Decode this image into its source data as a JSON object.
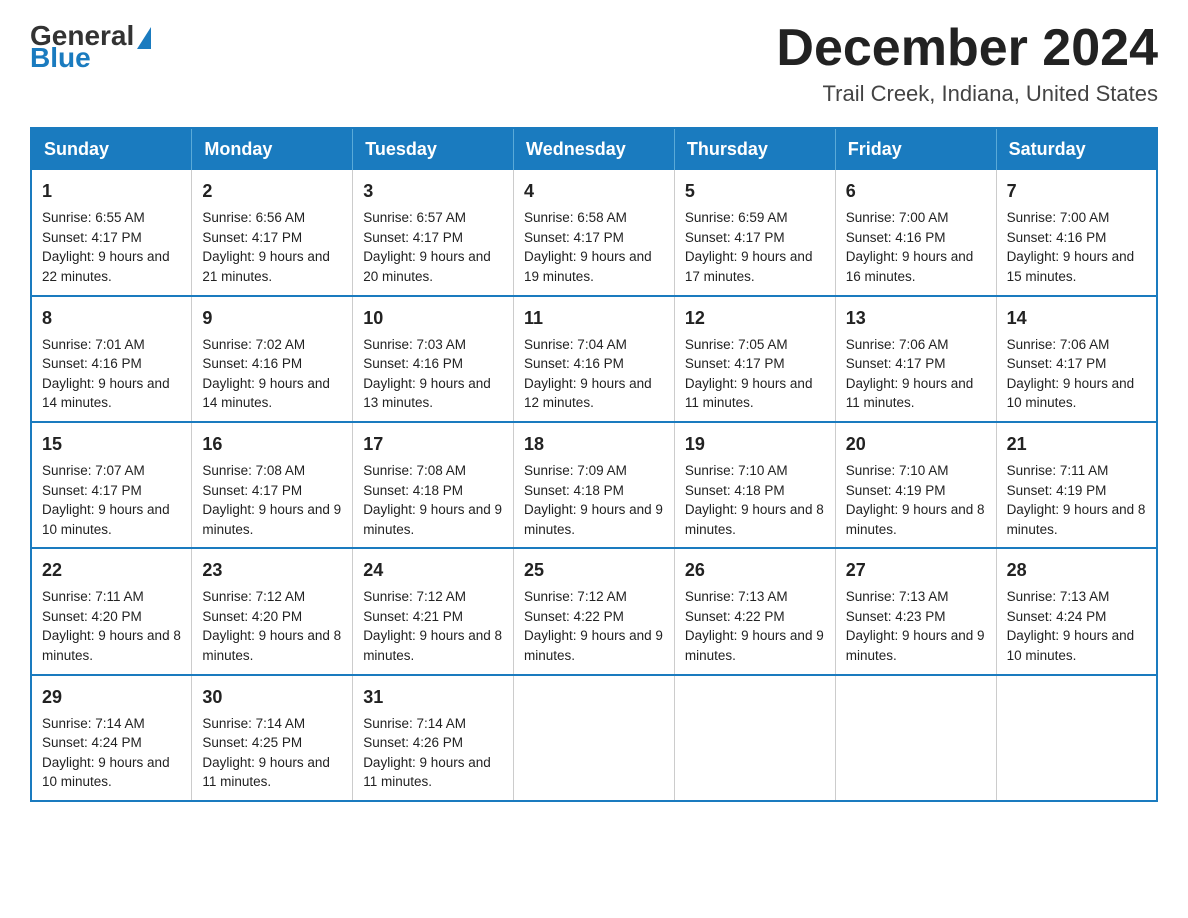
{
  "header": {
    "logo_general": "General",
    "logo_blue": "Blue",
    "month_title": "December 2024",
    "location": "Trail Creek, Indiana, United States"
  },
  "days_of_week": [
    "Sunday",
    "Monday",
    "Tuesday",
    "Wednesday",
    "Thursday",
    "Friday",
    "Saturday"
  ],
  "weeks": [
    [
      {
        "day": "1",
        "sunrise": "6:55 AM",
        "sunset": "4:17 PM",
        "daylight": "9 hours and 22 minutes."
      },
      {
        "day": "2",
        "sunrise": "6:56 AM",
        "sunset": "4:17 PM",
        "daylight": "9 hours and 21 minutes."
      },
      {
        "day": "3",
        "sunrise": "6:57 AM",
        "sunset": "4:17 PM",
        "daylight": "9 hours and 20 minutes."
      },
      {
        "day": "4",
        "sunrise": "6:58 AM",
        "sunset": "4:17 PM",
        "daylight": "9 hours and 19 minutes."
      },
      {
        "day": "5",
        "sunrise": "6:59 AM",
        "sunset": "4:17 PM",
        "daylight": "9 hours and 17 minutes."
      },
      {
        "day": "6",
        "sunrise": "7:00 AM",
        "sunset": "4:16 PM",
        "daylight": "9 hours and 16 minutes."
      },
      {
        "day": "7",
        "sunrise": "7:00 AM",
        "sunset": "4:16 PM",
        "daylight": "9 hours and 15 minutes."
      }
    ],
    [
      {
        "day": "8",
        "sunrise": "7:01 AM",
        "sunset": "4:16 PM",
        "daylight": "9 hours and 14 minutes."
      },
      {
        "day": "9",
        "sunrise": "7:02 AM",
        "sunset": "4:16 PM",
        "daylight": "9 hours and 14 minutes."
      },
      {
        "day": "10",
        "sunrise": "7:03 AM",
        "sunset": "4:16 PM",
        "daylight": "9 hours and 13 minutes."
      },
      {
        "day": "11",
        "sunrise": "7:04 AM",
        "sunset": "4:16 PM",
        "daylight": "9 hours and 12 minutes."
      },
      {
        "day": "12",
        "sunrise": "7:05 AM",
        "sunset": "4:17 PM",
        "daylight": "9 hours and 11 minutes."
      },
      {
        "day": "13",
        "sunrise": "7:06 AM",
        "sunset": "4:17 PM",
        "daylight": "9 hours and 11 minutes."
      },
      {
        "day": "14",
        "sunrise": "7:06 AM",
        "sunset": "4:17 PM",
        "daylight": "9 hours and 10 minutes."
      }
    ],
    [
      {
        "day": "15",
        "sunrise": "7:07 AM",
        "sunset": "4:17 PM",
        "daylight": "9 hours and 10 minutes."
      },
      {
        "day": "16",
        "sunrise": "7:08 AM",
        "sunset": "4:17 PM",
        "daylight": "9 hours and 9 minutes."
      },
      {
        "day": "17",
        "sunrise": "7:08 AM",
        "sunset": "4:18 PM",
        "daylight": "9 hours and 9 minutes."
      },
      {
        "day": "18",
        "sunrise": "7:09 AM",
        "sunset": "4:18 PM",
        "daylight": "9 hours and 9 minutes."
      },
      {
        "day": "19",
        "sunrise": "7:10 AM",
        "sunset": "4:18 PM",
        "daylight": "9 hours and 8 minutes."
      },
      {
        "day": "20",
        "sunrise": "7:10 AM",
        "sunset": "4:19 PM",
        "daylight": "9 hours and 8 minutes."
      },
      {
        "day": "21",
        "sunrise": "7:11 AM",
        "sunset": "4:19 PM",
        "daylight": "9 hours and 8 minutes."
      }
    ],
    [
      {
        "day": "22",
        "sunrise": "7:11 AM",
        "sunset": "4:20 PM",
        "daylight": "9 hours and 8 minutes."
      },
      {
        "day": "23",
        "sunrise": "7:12 AM",
        "sunset": "4:20 PM",
        "daylight": "9 hours and 8 minutes."
      },
      {
        "day": "24",
        "sunrise": "7:12 AM",
        "sunset": "4:21 PM",
        "daylight": "9 hours and 8 minutes."
      },
      {
        "day": "25",
        "sunrise": "7:12 AM",
        "sunset": "4:22 PM",
        "daylight": "9 hours and 9 minutes."
      },
      {
        "day": "26",
        "sunrise": "7:13 AM",
        "sunset": "4:22 PM",
        "daylight": "9 hours and 9 minutes."
      },
      {
        "day": "27",
        "sunrise": "7:13 AM",
        "sunset": "4:23 PM",
        "daylight": "9 hours and 9 minutes."
      },
      {
        "day": "28",
        "sunrise": "7:13 AM",
        "sunset": "4:24 PM",
        "daylight": "9 hours and 10 minutes."
      }
    ],
    [
      {
        "day": "29",
        "sunrise": "7:14 AM",
        "sunset": "4:24 PM",
        "daylight": "9 hours and 10 minutes."
      },
      {
        "day": "30",
        "sunrise": "7:14 AM",
        "sunset": "4:25 PM",
        "daylight": "9 hours and 11 minutes."
      },
      {
        "day": "31",
        "sunrise": "7:14 AM",
        "sunset": "4:26 PM",
        "daylight": "9 hours and 11 minutes."
      },
      null,
      null,
      null,
      null
    ]
  ]
}
